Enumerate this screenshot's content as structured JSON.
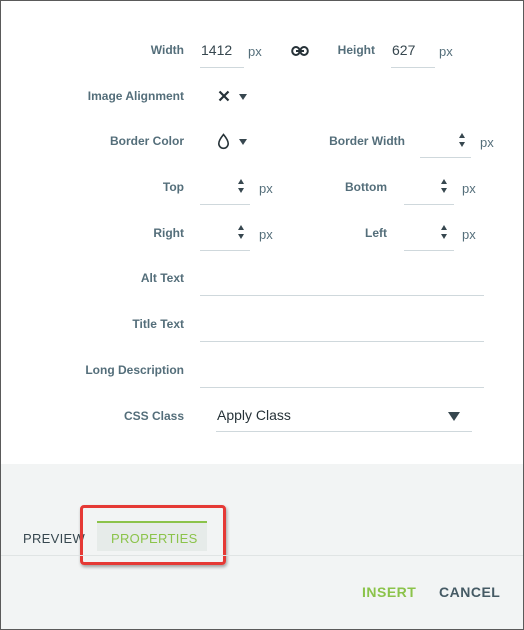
{
  "dimensions": {
    "width_label": "Width",
    "width_value": "1412",
    "height_label": "Height",
    "height_value": "627",
    "unit": "px"
  },
  "image_alignment_label": "Image Alignment",
  "border": {
    "color_label": "Border Color",
    "width_label": "Border Width"
  },
  "spacing": {
    "top_label": "Top",
    "bottom_label": "Bottom",
    "right_label": "Right",
    "left_label": "Left"
  },
  "alt_text_label": "Alt Text",
  "title_text_label": "Title Text",
  "long_description_label": "Long Description",
  "css_class": {
    "label": "CSS Class",
    "selected": "Apply Class"
  },
  "tabs": {
    "preview": "PREVIEW",
    "properties": "PROPERTIES"
  },
  "actions": {
    "insert": "INSERT",
    "cancel": "CANCEL"
  },
  "colors": {
    "label": "#546e7a",
    "accent_green": "#8bc34a",
    "highlight_red": "#e53935",
    "footer_bg": "#f2f4f4"
  }
}
